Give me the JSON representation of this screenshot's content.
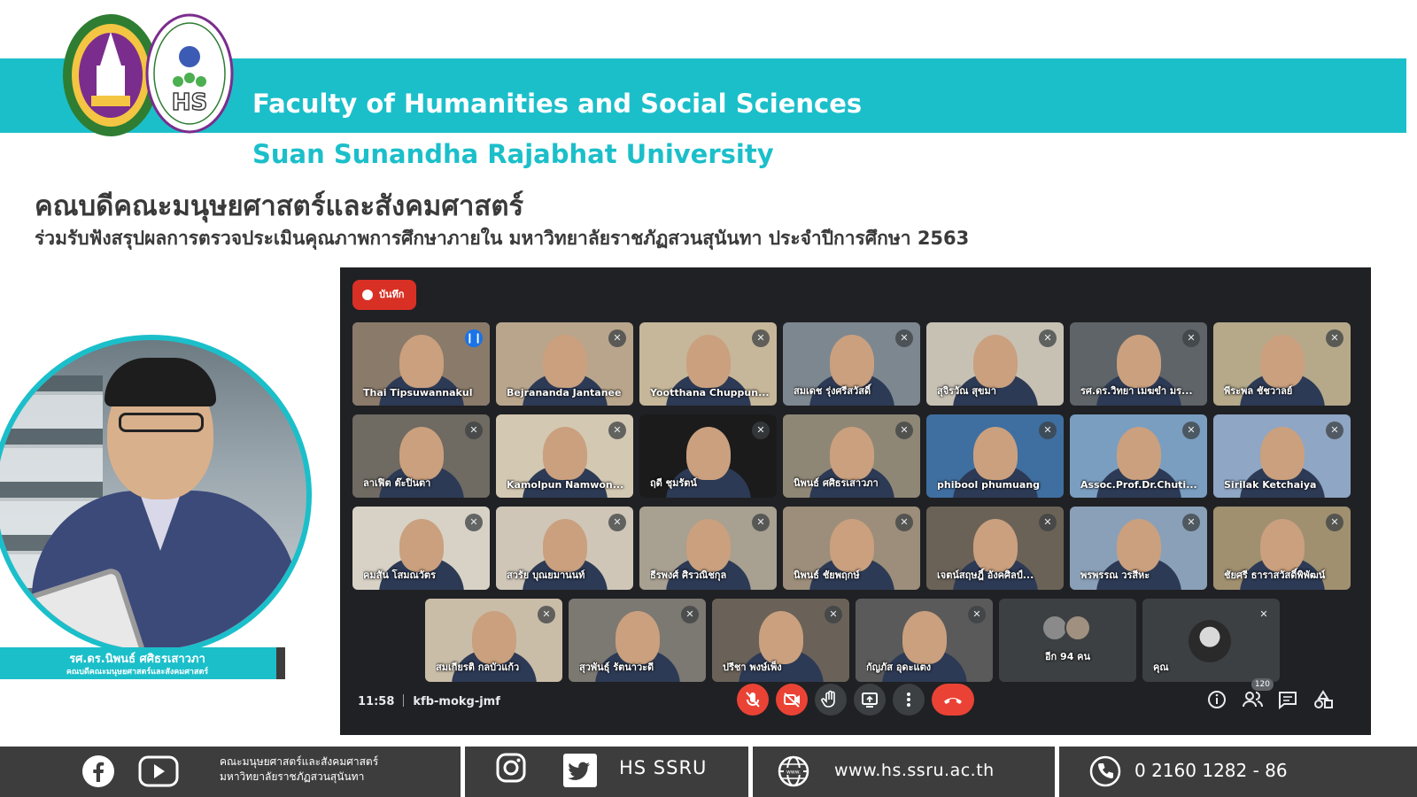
{
  "header": {
    "faculty_en": "Faculty of Humanities and Social Sciences",
    "university_en": "Suan Sunandha Rajabhat University",
    "headline_th": "คณบดีคณะมนุษยศาสตร์และสังคมศาสตร์",
    "subline_th": "ร่วมรับฟังสรุปผลการตรวจประเมินคุณภาพการศึกษาภายใน มหาวิทยาลัยราชภัฏสวนสุนันทา ประจำปีการศึกษา 2563"
  },
  "dean": {
    "name": "รศ.ดร.นิพนธ์ ศศิธรเสาวภา",
    "title": "คณบดีคณะมนุษยศาสตร์และสังคมศาสตร์"
  },
  "meet": {
    "record_label": "บันทึก",
    "time": "11:58",
    "meeting_code": "kfb-mokg-jmf",
    "participants_count": "120",
    "participants": [
      "Thai Tipsuwannakul",
      "Bejrananda Jantanee",
      "Yootthana Chuppun...",
      "สมเดช รุ่งศรีสวัสดิ์",
      "สุจิรวัณ สุขมา",
      "รศ.ดร.วิทยา เมฆขำ มร...",
      "พีระพล ชัชวาลย์",
      "ลาเฟิต ต๊ะปินตา",
      "Kamolpun Namwon...",
      "ฤดี ชุมรัตน์",
      "นิพนธ์ ศศิธรเสาวภา",
      "phibool phumuang",
      "Assoc.Prof.Dr.Chuti...",
      "Sirilak Ketchaiya",
      "คมสัน โสมณวัตร",
      "สวรัย บุณยมานนท์",
      "ธีรพงศ์ ศิรวณิชกุล",
      "นิพนธ์ ชัยพฤกษ์",
      "เจตน์สฤษฎิ์ อังคศิลป์...",
      "พรพรรณ วรสีหะ",
      "ชัยศรี ธาราสวัสดิ์พิพัฒน์",
      "สมเกียรติ กลบัวแก้ว",
      "สุวพันธุ์ รัตนาวะดี",
      "ปรีชา พงษ์เพ็ง",
      "กัญภัส อุดะแตง"
    ],
    "more_label": "อีก 94 คน",
    "self_label": "คุณ"
  },
  "footer": {
    "org_line1": "คณะมนุษยศาสตร์และสังคมศาสตร์",
    "org_line2": "มหาวิทยาลัยราชภัฏสวนสุนันทา",
    "social_handle": "HS SSRU",
    "website": "www.hs.ssru.ac.th",
    "phone": "0  2160 1282 - 86"
  },
  "colors": {
    "teal": "#1bbfca",
    "meet_bg": "#202124",
    "footer_bg": "#3d3d3d",
    "record_red": "#d93025"
  },
  "icons": [
    "facebook-icon",
    "youtube-icon",
    "instagram-icon",
    "twitter-icon",
    "globe-icon",
    "phone-icon",
    "mic-off-icon",
    "camera-off-icon",
    "raise-hand-icon",
    "present-icon",
    "more-options-icon",
    "hang-up-icon",
    "info-icon",
    "people-icon",
    "chat-icon",
    "activities-icon"
  ]
}
